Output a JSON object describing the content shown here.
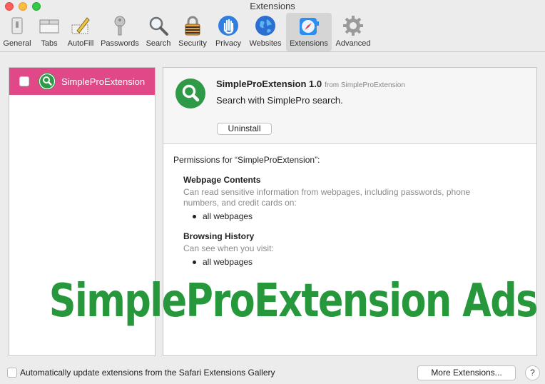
{
  "window": {
    "title": "Extensions"
  },
  "toolbar": {
    "items": [
      {
        "label": "General",
        "icon": "general-icon"
      },
      {
        "label": "Tabs",
        "icon": "tabs-icon"
      },
      {
        "label": "AutoFill",
        "icon": "autofill-icon"
      },
      {
        "label": "Passwords",
        "icon": "key-icon"
      },
      {
        "label": "Search",
        "icon": "search-icon"
      },
      {
        "label": "Security",
        "icon": "lock-icon"
      },
      {
        "label": "Privacy",
        "icon": "hand-icon"
      },
      {
        "label": "Websites",
        "icon": "globe-icon"
      },
      {
        "label": "Extensions",
        "icon": "extensions-icon",
        "active": true
      },
      {
        "label": "Advanced",
        "icon": "gear-icon"
      }
    ]
  },
  "extension_list": {
    "items": [
      {
        "name": "SimpleProExtension",
        "enabled": false,
        "selected": true
      }
    ]
  },
  "detail": {
    "name_version": "SimpleProExtension 1.0",
    "from": "from SimpleProExtension",
    "description": "Search with SimplePro search.",
    "uninstall_label": "Uninstall",
    "permissions_intro": "Permissions for “SimpleProExtension”:",
    "permissions": [
      {
        "title": "Webpage Contents",
        "description": "Can read sensitive information from webpages, including passwords, phone numbers, and credit cards on:",
        "scope": "all webpages"
      },
      {
        "title": "Browsing History",
        "description": "Can see when you visit:",
        "scope": "all webpages"
      }
    ]
  },
  "overlay": {
    "text": "SimpleProExtension Ads",
    "color": "#27973c"
  },
  "footer": {
    "auto_update_label": "Automatically update extensions from the Safari Extensions Gallery",
    "more_extensions_label": "More Extensions...",
    "help_label": "?"
  },
  "colors": {
    "selected_row": "#e04888",
    "extension_icon": "#2e9a47"
  }
}
